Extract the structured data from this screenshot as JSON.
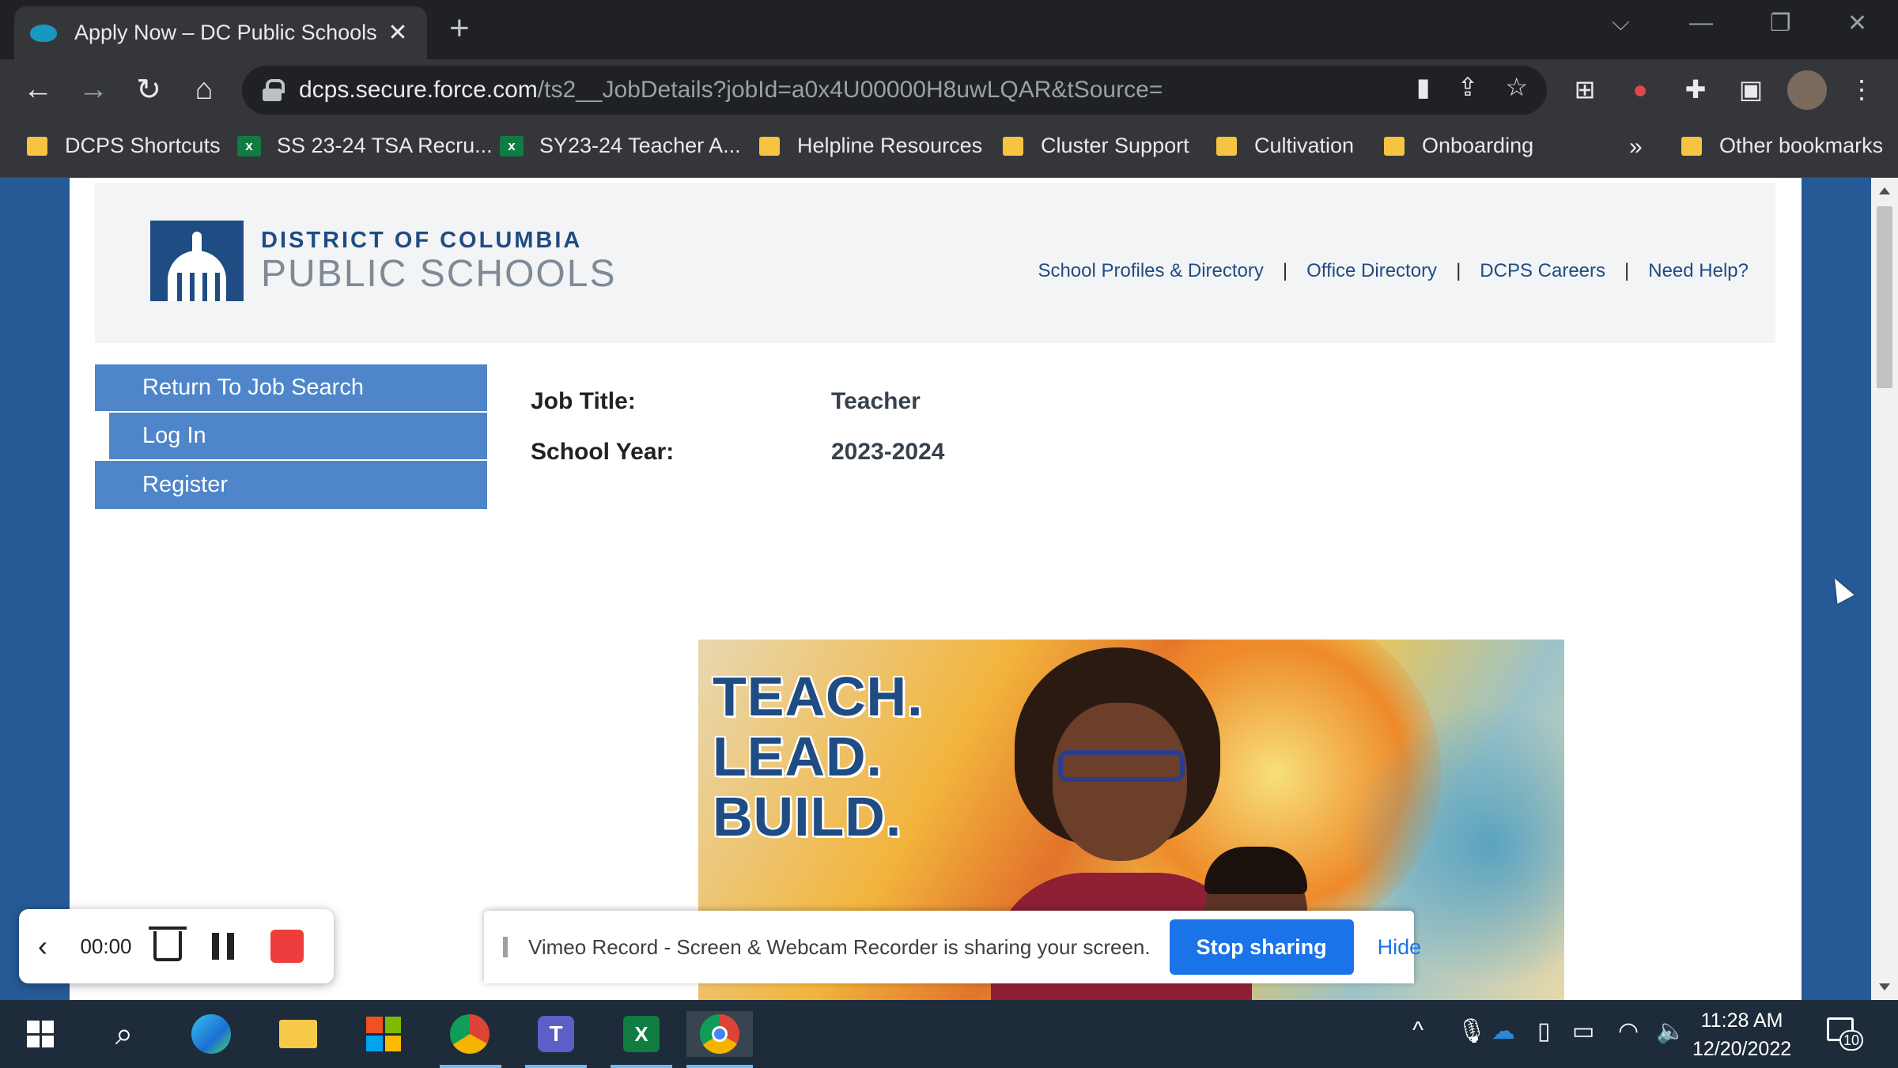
{
  "browser": {
    "tab_title": "Apply Now – DC Public Schools",
    "tab_close": "✕",
    "new_tab": "+",
    "url_host": "dcps.secure.force.com",
    "url_path": "/ts2__JobDetails?jobId=a0x4U00000H8uwLQAR&tSource=",
    "nav": {
      "back": "←",
      "forward": "→",
      "reload": "↻",
      "home": "⌂"
    },
    "omnibox_icons": {
      "camera": "▮",
      "share": "⇪",
      "star": "☆"
    },
    "extensions": {
      "ext1": "⊞",
      "ext2": "●",
      "puzzle": "✚",
      "sidepanel": "▣",
      "menu": "⋮"
    }
  },
  "bookmarks": [
    {
      "label": "DCPS Shortcuts",
      "type": "folder"
    },
    {
      "label": "SS 23-24 TSA Recru...",
      "type": "excel"
    },
    {
      "label": "SY23-24 Teacher A...",
      "type": "excel"
    },
    {
      "label": "Helpline Resources",
      "type": "folder"
    },
    {
      "label": "Cluster Support",
      "type": "folder"
    },
    {
      "label": "Cultivation",
      "type": "folder"
    },
    {
      "label": "Onboarding",
      "type": "folder"
    },
    {
      "label": "»",
      "type": "overflow"
    },
    {
      "label": "Other bookmarks",
      "type": "folder"
    }
  ],
  "site": {
    "logo_line1": "DISTRICT OF COLUMBIA",
    "logo_line2": "PUBLIC SCHOOLS",
    "top_links": [
      "School Profiles & Directory",
      "Office Directory",
      "DCPS Careers",
      "Need Help?"
    ],
    "separator": "|",
    "side_nav": [
      "Return To Job Search",
      "Log In",
      "Register"
    ],
    "job": {
      "title_label": "Job Title:",
      "title_value": "Teacher",
      "year_label": "School Year:",
      "year_value": "2023-2024"
    },
    "banner_slogan": [
      "TEACH.",
      "LEAD.",
      "BUILD."
    ]
  },
  "recorder": {
    "back": "‹",
    "time": "00:00",
    "stop_color": "#ee3d3d"
  },
  "sharebar": {
    "message": "Vimeo Record - Screen & Webcam Recorder is sharing your screen.",
    "stop_label": "Stop sharing",
    "hide_label": "Hide"
  },
  "taskbar": {
    "search": "⌕",
    "tray_chevron": "^",
    "time": "11:28 AM",
    "date": "12/20/2022",
    "notification_count": "10"
  },
  "colors": {
    "brand_blue": "#1f4c82",
    "nav_blue": "#4f86c9",
    "page_bg_blue": "#265a96",
    "chrome_dark": "#202124",
    "share_blue": "#1a73e8"
  }
}
